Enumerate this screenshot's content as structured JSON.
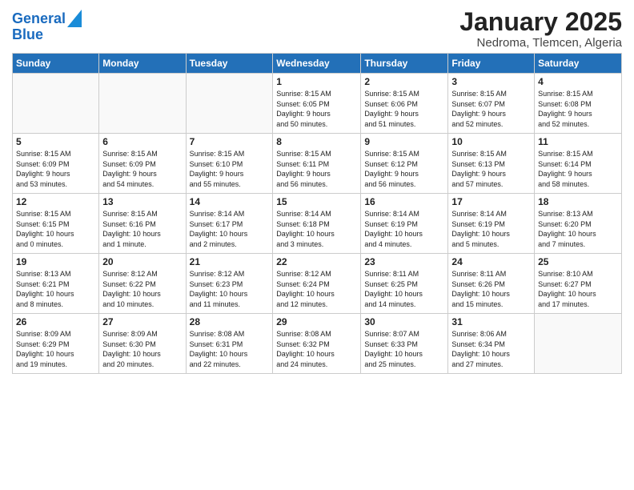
{
  "logo": {
    "line1": "General",
    "line2": "Blue"
  },
  "title": "January 2025",
  "location": "Nedroma, Tlemcen, Algeria",
  "weekdays": [
    "Sunday",
    "Monday",
    "Tuesday",
    "Wednesday",
    "Thursday",
    "Friday",
    "Saturday"
  ],
  "weeks": [
    [
      {
        "day": "",
        "info": ""
      },
      {
        "day": "",
        "info": ""
      },
      {
        "day": "",
        "info": ""
      },
      {
        "day": "1",
        "info": "Sunrise: 8:15 AM\nSunset: 6:05 PM\nDaylight: 9 hours\nand 50 minutes."
      },
      {
        "day": "2",
        "info": "Sunrise: 8:15 AM\nSunset: 6:06 PM\nDaylight: 9 hours\nand 51 minutes."
      },
      {
        "day": "3",
        "info": "Sunrise: 8:15 AM\nSunset: 6:07 PM\nDaylight: 9 hours\nand 52 minutes."
      },
      {
        "day": "4",
        "info": "Sunrise: 8:15 AM\nSunset: 6:08 PM\nDaylight: 9 hours\nand 52 minutes."
      }
    ],
    [
      {
        "day": "5",
        "info": "Sunrise: 8:15 AM\nSunset: 6:09 PM\nDaylight: 9 hours\nand 53 minutes."
      },
      {
        "day": "6",
        "info": "Sunrise: 8:15 AM\nSunset: 6:09 PM\nDaylight: 9 hours\nand 54 minutes."
      },
      {
        "day": "7",
        "info": "Sunrise: 8:15 AM\nSunset: 6:10 PM\nDaylight: 9 hours\nand 55 minutes."
      },
      {
        "day": "8",
        "info": "Sunrise: 8:15 AM\nSunset: 6:11 PM\nDaylight: 9 hours\nand 56 minutes."
      },
      {
        "day": "9",
        "info": "Sunrise: 8:15 AM\nSunset: 6:12 PM\nDaylight: 9 hours\nand 56 minutes."
      },
      {
        "day": "10",
        "info": "Sunrise: 8:15 AM\nSunset: 6:13 PM\nDaylight: 9 hours\nand 57 minutes."
      },
      {
        "day": "11",
        "info": "Sunrise: 8:15 AM\nSunset: 6:14 PM\nDaylight: 9 hours\nand 58 minutes."
      }
    ],
    [
      {
        "day": "12",
        "info": "Sunrise: 8:15 AM\nSunset: 6:15 PM\nDaylight: 10 hours\nand 0 minutes."
      },
      {
        "day": "13",
        "info": "Sunrise: 8:15 AM\nSunset: 6:16 PM\nDaylight: 10 hours\nand 1 minute."
      },
      {
        "day": "14",
        "info": "Sunrise: 8:14 AM\nSunset: 6:17 PM\nDaylight: 10 hours\nand 2 minutes."
      },
      {
        "day": "15",
        "info": "Sunrise: 8:14 AM\nSunset: 6:18 PM\nDaylight: 10 hours\nand 3 minutes."
      },
      {
        "day": "16",
        "info": "Sunrise: 8:14 AM\nSunset: 6:19 PM\nDaylight: 10 hours\nand 4 minutes."
      },
      {
        "day": "17",
        "info": "Sunrise: 8:14 AM\nSunset: 6:19 PM\nDaylight: 10 hours\nand 5 minutes."
      },
      {
        "day": "18",
        "info": "Sunrise: 8:13 AM\nSunset: 6:20 PM\nDaylight: 10 hours\nand 7 minutes."
      }
    ],
    [
      {
        "day": "19",
        "info": "Sunrise: 8:13 AM\nSunset: 6:21 PM\nDaylight: 10 hours\nand 8 minutes."
      },
      {
        "day": "20",
        "info": "Sunrise: 8:12 AM\nSunset: 6:22 PM\nDaylight: 10 hours\nand 10 minutes."
      },
      {
        "day": "21",
        "info": "Sunrise: 8:12 AM\nSunset: 6:23 PM\nDaylight: 10 hours\nand 11 minutes."
      },
      {
        "day": "22",
        "info": "Sunrise: 8:12 AM\nSunset: 6:24 PM\nDaylight: 10 hours\nand 12 minutes."
      },
      {
        "day": "23",
        "info": "Sunrise: 8:11 AM\nSunset: 6:25 PM\nDaylight: 10 hours\nand 14 minutes."
      },
      {
        "day": "24",
        "info": "Sunrise: 8:11 AM\nSunset: 6:26 PM\nDaylight: 10 hours\nand 15 minutes."
      },
      {
        "day": "25",
        "info": "Sunrise: 8:10 AM\nSunset: 6:27 PM\nDaylight: 10 hours\nand 17 minutes."
      }
    ],
    [
      {
        "day": "26",
        "info": "Sunrise: 8:09 AM\nSunset: 6:29 PM\nDaylight: 10 hours\nand 19 minutes."
      },
      {
        "day": "27",
        "info": "Sunrise: 8:09 AM\nSunset: 6:30 PM\nDaylight: 10 hours\nand 20 minutes."
      },
      {
        "day": "28",
        "info": "Sunrise: 8:08 AM\nSunset: 6:31 PM\nDaylight: 10 hours\nand 22 minutes."
      },
      {
        "day": "29",
        "info": "Sunrise: 8:08 AM\nSunset: 6:32 PM\nDaylight: 10 hours\nand 24 minutes."
      },
      {
        "day": "30",
        "info": "Sunrise: 8:07 AM\nSunset: 6:33 PM\nDaylight: 10 hours\nand 25 minutes."
      },
      {
        "day": "31",
        "info": "Sunrise: 8:06 AM\nSunset: 6:34 PM\nDaylight: 10 hours\nand 27 minutes."
      },
      {
        "day": "",
        "info": ""
      }
    ]
  ]
}
